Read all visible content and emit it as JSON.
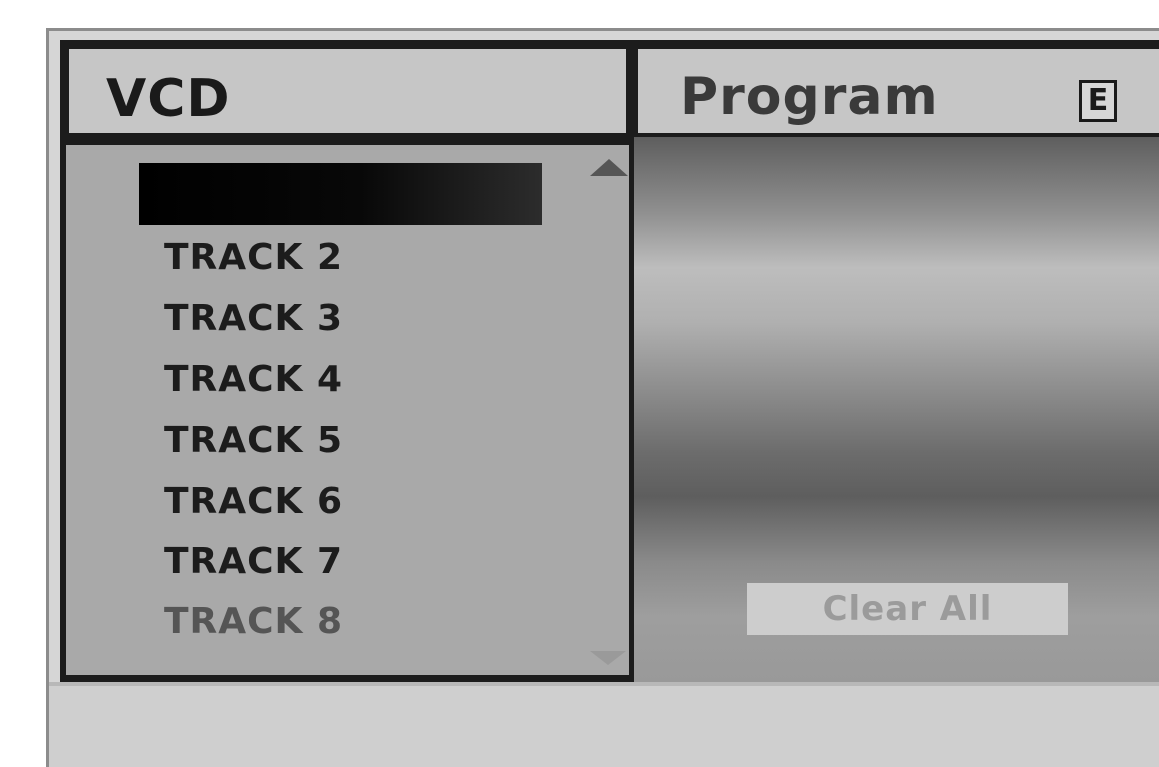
{
  "left_panel": {
    "title": "VCD",
    "selected_item": "",
    "tracks": [
      {
        "label": "TRACK 2"
      },
      {
        "label": "TRACK 3"
      },
      {
        "label": "TRACK 4"
      },
      {
        "label": "TRACK 5"
      },
      {
        "label": "TRACK 6"
      },
      {
        "label": "TRACK 7"
      },
      {
        "label": "TRACK 8"
      }
    ]
  },
  "right_panel": {
    "title": "Program",
    "edit_icon_label": "E",
    "clear_all_label": "Clear All"
  },
  "colors": {
    "highlight": "#000000",
    "header_bg": "#c6c6c6",
    "list_bg": "#a9a9a9",
    "frame": "#1c1c1c"
  }
}
